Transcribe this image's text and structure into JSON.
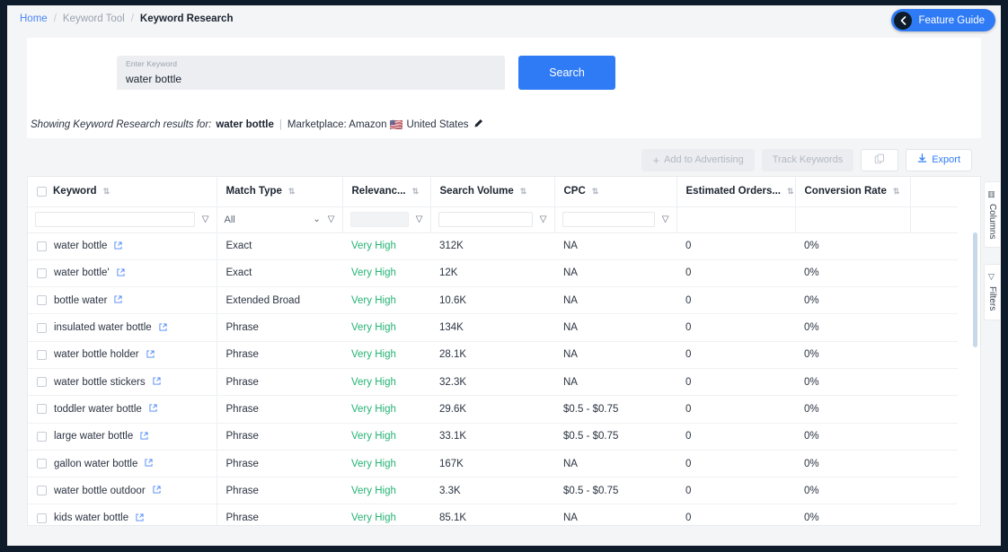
{
  "breadcrumb": {
    "home": "Home",
    "tool": "Keyword Tool",
    "current": "Keyword Research",
    "sep": "/"
  },
  "feature_guide": {
    "label": "Feature Guide",
    "icon": "chevron-left-icon",
    "bg": "#2f7bf6"
  },
  "search": {
    "field_label": "Enter Keyword",
    "field_value": "water bottle",
    "placeholder": "Enter Keyword",
    "button_label": "Search",
    "button_color": "#2f7bf6"
  },
  "showing": {
    "prefix": "Showing Keyword Research results for:",
    "keyword": "water bottle",
    "separator": "|",
    "marketplace_label": "Marketplace: Amazon",
    "flag": "🇺🇸",
    "country": "United States",
    "edit_icon": "pencil-icon"
  },
  "toolbar": {
    "add_to_advertising": "Add to Advertising",
    "track_keywords": "Track Keywords",
    "copy_icon": "copy-icon",
    "export": "Export",
    "export_icon": "download-icon"
  },
  "table": {
    "columns": [
      {
        "label": "Keyword",
        "sortable": true
      },
      {
        "label": "Match Type",
        "sortable": true
      },
      {
        "label": "Relevanc...",
        "sortable": true
      },
      {
        "label": "Search Volume",
        "sortable": true
      },
      {
        "label": "CPC",
        "sortable": true
      },
      {
        "label": "Estimated Orders...",
        "sortable": true
      },
      {
        "label": "Conversion Rate",
        "sortable": true
      },
      {
        "label": "",
        "sortable": false
      }
    ],
    "filters": {
      "keyword": "",
      "match_type": "All",
      "relevance": "",
      "search_volume": "",
      "cpc": "",
      "filter_icon": "filter-icon",
      "chevron": "chevron-down-icon"
    },
    "rows": [
      {
        "keyword": "water bottle",
        "match_type": "Exact",
        "relevance": "Very High",
        "search_volume": "312K",
        "cpc": "NA",
        "orders": "0",
        "conversion": "0%"
      },
      {
        "keyword": "water bottle'",
        "match_type": "Exact",
        "relevance": "Very High",
        "search_volume": "12K",
        "cpc": "NA",
        "orders": "0",
        "conversion": "0%"
      },
      {
        "keyword": "bottle water",
        "match_type": "Extended Broad",
        "relevance": "Very High",
        "search_volume": "10.6K",
        "cpc": "NA",
        "orders": "0",
        "conversion": "0%"
      },
      {
        "keyword": "insulated water bottle",
        "match_type": "Phrase",
        "relevance": "Very High",
        "search_volume": "134K",
        "cpc": "NA",
        "orders": "0",
        "conversion": "0%"
      },
      {
        "keyword": "water bottle holder",
        "match_type": "Phrase",
        "relevance": "Very High",
        "search_volume": "28.1K",
        "cpc": "NA",
        "orders": "0",
        "conversion": "0%"
      },
      {
        "keyword": "water bottle stickers",
        "match_type": "Phrase",
        "relevance": "Very High",
        "search_volume": "32.3K",
        "cpc": "NA",
        "orders": "0",
        "conversion": "0%"
      },
      {
        "keyword": "toddler water bottle",
        "match_type": "Phrase",
        "relevance": "Very High",
        "search_volume": "29.6K",
        "cpc": "$0.5 - $0.75",
        "orders": "0",
        "conversion": "0%"
      },
      {
        "keyword": "large water bottle",
        "match_type": "Phrase",
        "relevance": "Very High",
        "search_volume": "33.1K",
        "cpc": "$0.5 - $0.75",
        "orders": "0",
        "conversion": "0%"
      },
      {
        "keyword": "gallon water bottle",
        "match_type": "Phrase",
        "relevance": "Very High",
        "search_volume": "167K",
        "cpc": "NA",
        "orders": "0",
        "conversion": "0%"
      },
      {
        "keyword": "water bottle outdoor",
        "match_type": "Phrase",
        "relevance": "Very High",
        "search_volume": "3.3K",
        "cpc": "$0.5 - $0.75",
        "orders": "0",
        "conversion": "0%"
      },
      {
        "keyword": "kids water bottle",
        "match_type": "Phrase",
        "relevance": "Very High",
        "search_volume": "85.1K",
        "cpc": "NA",
        "orders": "0",
        "conversion": "0%"
      }
    ],
    "relevance_color": "#25b374",
    "link_color": "#4a86f7"
  },
  "rail": {
    "columns_label": "Columns",
    "columns_icon": "columns-icon",
    "filters_label": "Filters",
    "filters_icon": "filter-icon"
  }
}
